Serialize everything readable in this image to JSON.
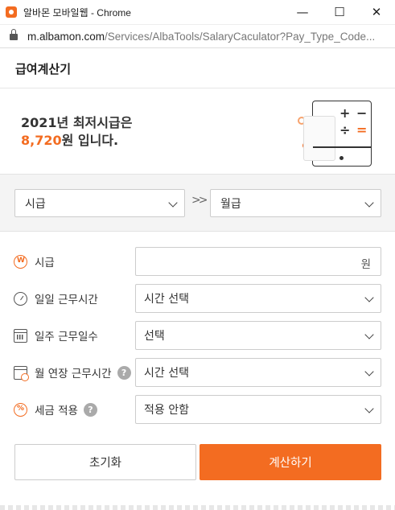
{
  "window": {
    "title": "알바몬 모바일웹 - Chrome",
    "url_host": "m.albamon.com",
    "url_path": "/Services/AlbaTools/SalaryCaculator?Pay_Type_Code..."
  },
  "header": {
    "title": "급여계산기"
  },
  "banner": {
    "line1": "2021년 최저시급은",
    "wage": "8,720",
    "line2_suffix": "원 입니다."
  },
  "convert": {
    "from": "시급",
    "to": "월급",
    "arrow": "»"
  },
  "form": {
    "wage": {
      "label": "시급",
      "value": "",
      "unit": "원"
    },
    "daily_hours": {
      "label": "일일 근무시간",
      "value": "시간 선택"
    },
    "weekly_days": {
      "label": "일주 근무일수",
      "value": "선택"
    },
    "monthly_overtime": {
      "label": "월 연장 근무시간",
      "value": "시간 선택",
      "help": "?"
    },
    "tax": {
      "label": "세금 적용",
      "value": "적용 안함",
      "help": "?"
    }
  },
  "buttons": {
    "reset": "초기화",
    "calculate": "계산하기"
  },
  "colors": {
    "accent": "#f36c21"
  }
}
